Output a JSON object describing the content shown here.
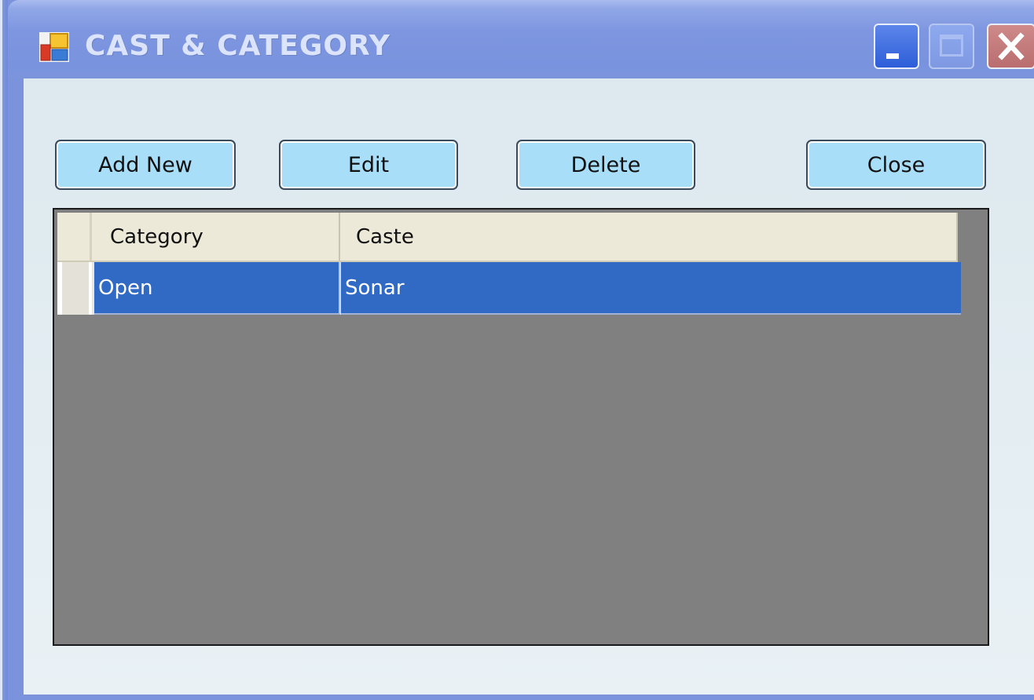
{
  "window": {
    "title": "CAST & CATEGORY",
    "controls": [
      "minimize-icon",
      "maximize-icon",
      "close-icon"
    ]
  },
  "toolbar": {
    "add_new_label": "Add New",
    "edit_label": "Edit",
    "delete_label": "Delete",
    "close_label": "Close"
  },
  "grid": {
    "columns": [
      "Category",
      "Caste"
    ],
    "rows": [
      {
        "category": "Open",
        "caste": "Sonar",
        "selected": true
      }
    ]
  },
  "colors": {
    "titlebar": "#7b93dc",
    "button_face": "#a8def8",
    "selection": "#316ac5",
    "grid_background": "#808080"
  }
}
